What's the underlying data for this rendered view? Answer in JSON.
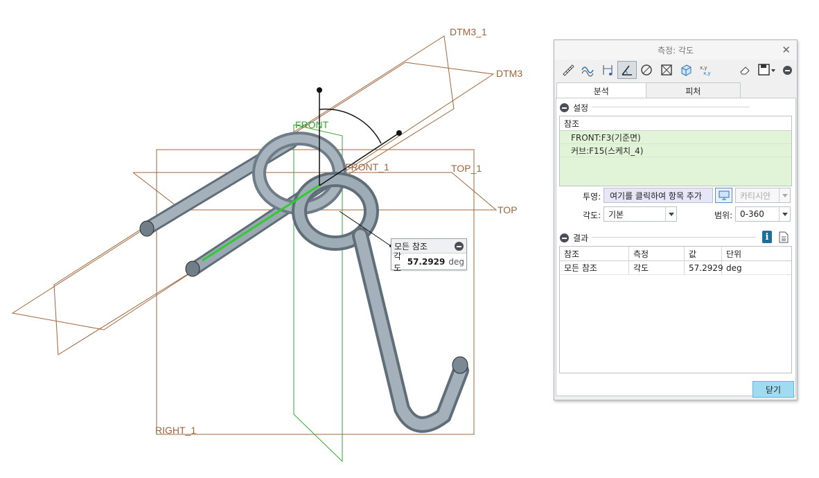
{
  "viewport": {
    "datums": {
      "dtm3_1": "DTM3_1",
      "dtm3": "DTM3",
      "front": "FRONT",
      "front_1": "FRONT_1",
      "top_1": "TOP_1",
      "top": "TOP",
      "right_1": "RIGHT_1"
    },
    "measure_tip": {
      "title": "모든 참조",
      "label": "각도",
      "value": "57.2929",
      "unit": "deg"
    }
  },
  "dialog": {
    "title": "측정: 각도",
    "close_icon": "close-icon",
    "toolbar": [
      "ruler-icon",
      "curve-icon",
      "distance-icon",
      "angle-icon",
      "diameter-icon",
      "area-icon",
      "volume-icon",
      "transform-icon",
      "eraser-icon",
      "save-icon",
      "collapse-icon"
    ],
    "tabs": {
      "analysis": "분석",
      "feature": "피처"
    },
    "setup": {
      "header": "설정",
      "references_header": "참조",
      "references": [
        "FRONT:F3(기준면)",
        "커브:F15(스케치_4)"
      ],
      "projection_label": "투영:",
      "projection_placeholder": "여기를 클릭하여 항목 추가",
      "coord_system": "카티시안",
      "angle_label": "각도:",
      "angle_value": "기본",
      "range_label": "범위:",
      "range_value": "0-360"
    },
    "results": {
      "header": "결과",
      "columns": [
        "참조",
        "측정",
        "값",
        "단위"
      ],
      "rows": [
        {
          "ref": "모든 참조",
          "measure": "각도",
          "value": "57.2929",
          "unit": "deg"
        }
      ]
    },
    "close_button": "닫기"
  },
  "colors": {
    "datum": "#a0643a",
    "front_datum": "#2faa2f",
    "model": "#8a9aa6",
    "accent_button": "#9fdcf2",
    "reference_bg": "#e2f4d8"
  }
}
